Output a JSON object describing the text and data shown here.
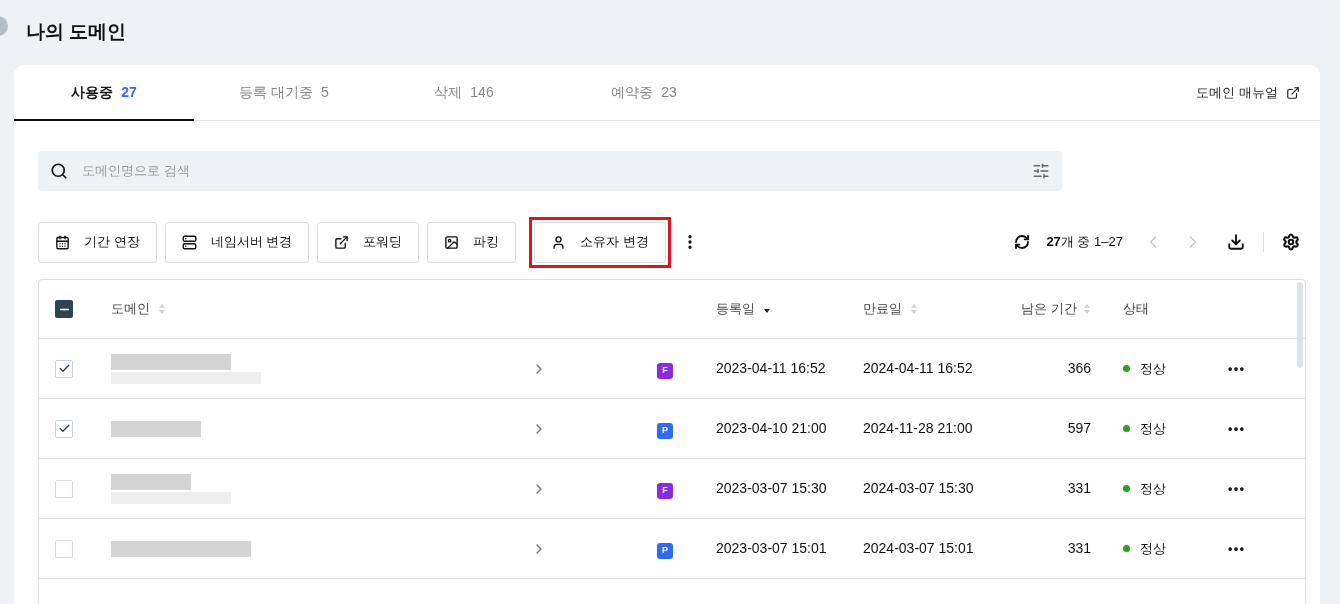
{
  "page_title": "나의 도메인",
  "tabs": [
    {
      "label": "사용중",
      "count": "27",
      "selected": true
    },
    {
      "label": "등록 대기중",
      "count": "5",
      "selected": false
    },
    {
      "label": "삭제",
      "count": "146",
      "selected": false
    },
    {
      "label": "예약중",
      "count": "23",
      "selected": false
    }
  ],
  "manual_link": "도메인 매뉴얼",
  "search": {
    "placeholder": "도메인명으로 검색"
  },
  "actions": [
    {
      "label": "기간 연장",
      "highlighted": false
    },
    {
      "label": "네임서버 변경",
      "highlighted": false
    },
    {
      "label": "포워딩",
      "highlighted": false
    },
    {
      "label": "파킹",
      "highlighted": false
    },
    {
      "label": "소유자 변경",
      "highlighted": true
    }
  ],
  "pagination": {
    "summary": "**27**개 중 1–27",
    "prev_disabled": true,
    "next_disabled": true
  },
  "table": {
    "select_all_indeterminate": true,
    "columns": [
      {
        "label": "도메인",
        "sortable": true,
        "sorted_desc": false
      },
      {
        "label": "등록일",
        "sortable": true,
        "sorted_desc": true
      },
      {
        "label": "만료일",
        "sortable": true,
        "sorted_desc": false
      },
      {
        "label": "남은 기간",
        "sortable": true,
        "sorted_desc": false
      },
      {
        "label": "상태"
      }
    ],
    "rows": [
      {
        "checked": true,
        "badge": {
          "label": "F",
          "color": "#8a2be2"
        },
        "registered": "2023-04-11 16:52",
        "expires": "2024-04-11 16:52",
        "remaining": "366",
        "status": {
          "label": "정상",
          "color": "#2ea01f"
        }
      },
      {
        "checked": true,
        "badge": {
          "label": "P",
          "color": "#2f6bf5"
        },
        "registered": "2023-04-10 21:00",
        "expires": "2024-11-28 21:00",
        "remaining": "597",
        "status": {
          "label": "정상",
          "color": "#2ea01f"
        }
      },
      {
        "checked": false,
        "badge": {
          "label": "F",
          "color": "#8a2be2"
        },
        "registered": "2023-03-07 15:30",
        "expires": "2024-03-07 15:30",
        "remaining": "331",
        "status": {
          "label": "정상",
          "color": "#2ea01f"
        }
      },
      {
        "checked": false,
        "badge": {
          "label": "P",
          "color": "#2f6bf5"
        },
        "registered": "2023-03-07 15:01",
        "expires": "2024-03-07 15:01",
        "remaining": "331",
        "status": {
          "label": "정상",
          "color": "#2ea01f"
        }
      }
    ]
  }
}
